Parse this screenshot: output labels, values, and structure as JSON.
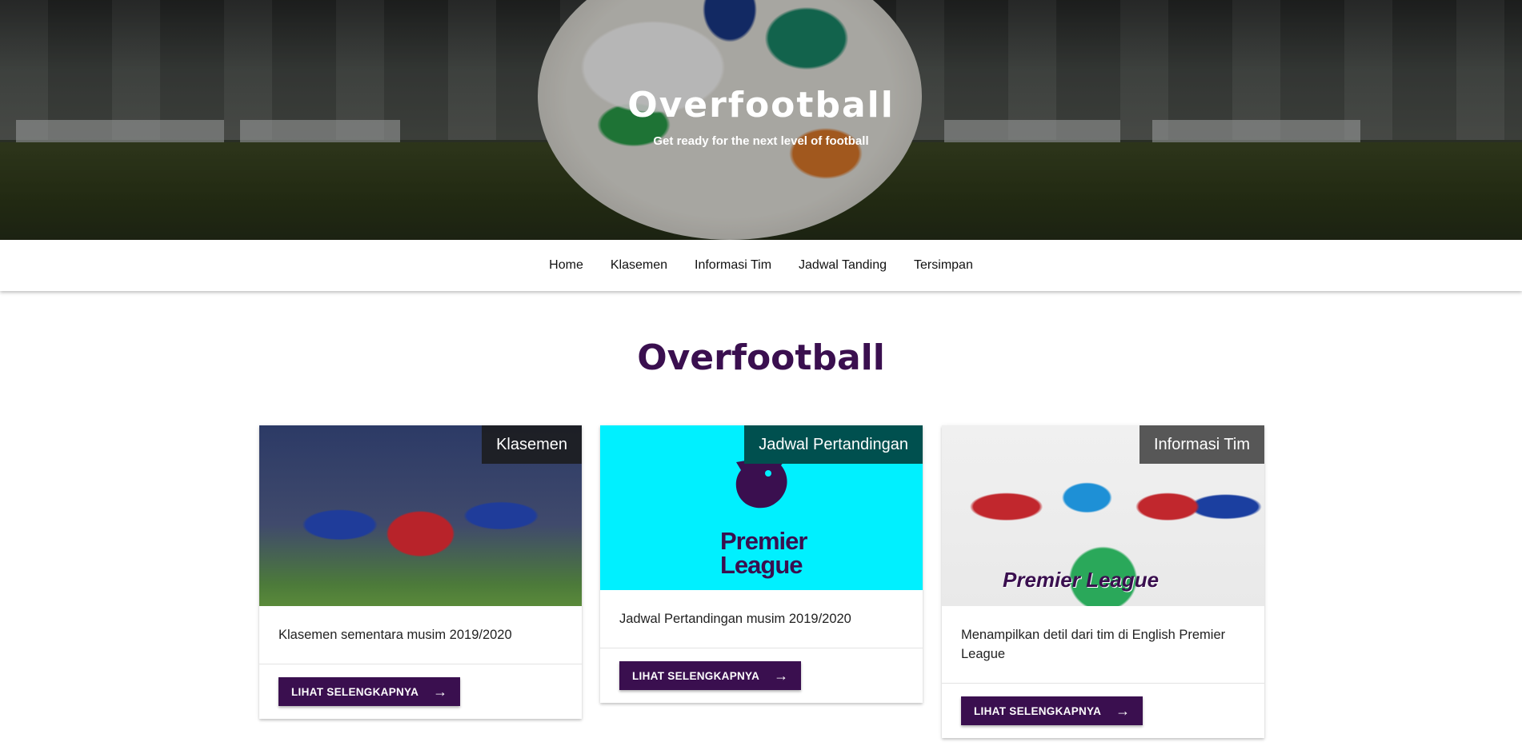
{
  "hero": {
    "title": "Overfootball",
    "subtitle": "Get ready for the next level of football"
  },
  "nav": {
    "items": [
      {
        "label": "Home"
      },
      {
        "label": "Klasemen"
      },
      {
        "label": "Informasi Tim"
      },
      {
        "label": "Jadwal Tanding"
      },
      {
        "label": "Tersimpan"
      }
    ]
  },
  "main": {
    "title": "Overfootball",
    "cards": [
      {
        "tag": "Klasemen",
        "tag_color": "#1b1b1b",
        "text": "Klasemen sementara musim 2019/2020",
        "button": "LIHAT SELENGKAPNYA"
      },
      {
        "tag": "Jadwal Pertandingan",
        "tag_color": "#00504f",
        "image_text": "Premier League",
        "text": "Jadwal Pertandingan musim 2019/2020",
        "button": "LIHAT SELENGKAPNYA"
      },
      {
        "tag": "Informasi Tim",
        "tag_color": "#4a4a4a",
        "image_text": "Premier League",
        "text": "Menampilkan detil dari tim di English Premier League",
        "button": "LIHAT SELENGKAPNYA"
      }
    ]
  },
  "colors": {
    "brand": "#3a0f4f",
    "cyan": "#00f0ff"
  },
  "icons": {
    "button_arrow": "arrow-right-icon"
  }
}
